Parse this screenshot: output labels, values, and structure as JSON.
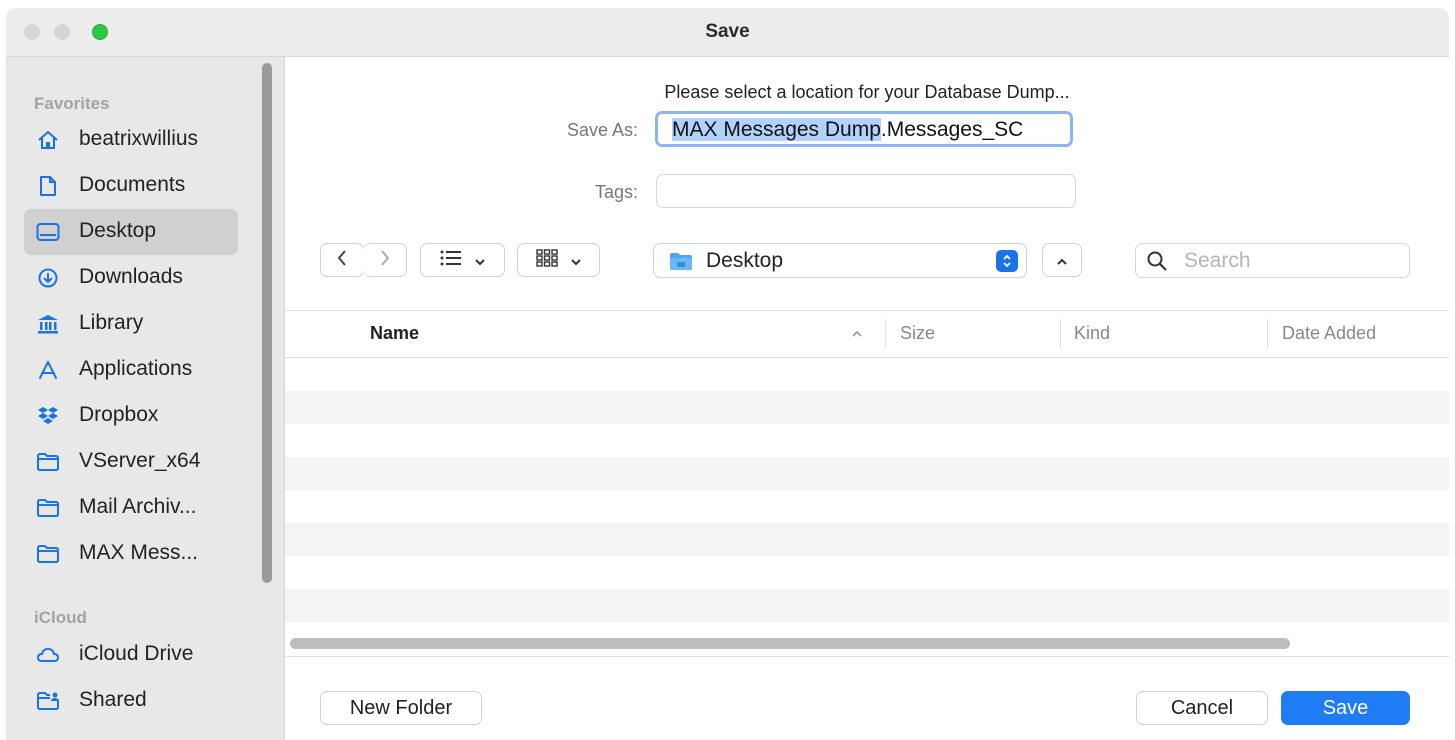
{
  "window": {
    "title": "Save"
  },
  "sidebar": {
    "favorites_header": "Favorites",
    "items": [
      {
        "label": "beatrixwillius",
        "icon": "home-icon"
      },
      {
        "label": "Documents",
        "icon": "document-icon"
      },
      {
        "label": "Desktop",
        "icon": "desktop-icon",
        "selected": true
      },
      {
        "label": "Downloads",
        "icon": "download-icon"
      },
      {
        "label": "Library",
        "icon": "library-icon"
      },
      {
        "label": "Applications",
        "icon": "applications-icon"
      },
      {
        "label": "Dropbox",
        "icon": "dropbox-icon"
      },
      {
        "label": "VServer_x64",
        "icon": "folder-icon"
      },
      {
        "label": "Mail Archiv...",
        "icon": "folder-icon"
      },
      {
        "label": "MAX Mess...",
        "icon": "folder-icon"
      }
    ],
    "icloud_header": "iCloud",
    "icloud_items": [
      {
        "label": "iCloud Drive",
        "icon": "cloud-icon"
      },
      {
        "label": "Shared",
        "icon": "shared-folder-icon"
      }
    ]
  },
  "dialog": {
    "prompt": "Please select a location for your Database Dump...",
    "save_as_label": "Save As:",
    "save_as_value_selected": "MAX Messages Dump",
    "save_as_value_rest": ".Messages_SC",
    "tags_label": "Tags:",
    "tags_value": ""
  },
  "toolbar": {
    "location": "Desktop",
    "search_placeholder": "Search"
  },
  "file_list": {
    "columns": [
      "Name",
      "Size",
      "Kind",
      "Date Added"
    ],
    "sorted_by": "Name",
    "rows": []
  },
  "buttons": {
    "new_folder": "New Folder",
    "cancel": "Cancel",
    "save": "Save"
  },
  "colors": {
    "accent": "#1f7cf5",
    "selection_highlight": "#b3d2fb",
    "sidebar_bg": "#e8e8e8"
  }
}
